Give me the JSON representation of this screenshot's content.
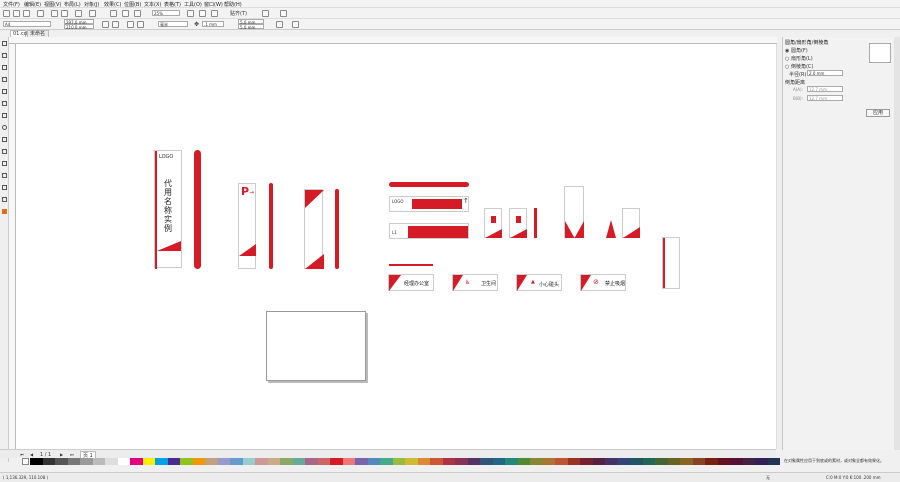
{
  "menu": [
    "文件(F)",
    "编辑(E)",
    "视图(V)",
    "布局(L)",
    "对象(J)",
    "效果(C)",
    "位图(B)",
    "文本(X)",
    "表格(T)",
    "工具(O)",
    "窗口(W)",
    "帮助(H)"
  ],
  "toolbar": {
    "zoom_value": "25%",
    "snap_label": "贴齐(T)",
    "page_size": "A4",
    "width_value": "297.0 mm",
    "height_value": "210.0 mm",
    "units_value": "毫米",
    "nudge_value": ".1 mm",
    "dup_x": "5.0 mm",
    "dup_y": "5.0 mm"
  },
  "doc_tabs": [
    "01.cdr",
    "未命名 -1"
  ],
  "panel": {
    "title": "圆角/扇形角/倒棱角",
    "options": [
      "圆角(F)",
      "扇形角(L)",
      "倒棱角(C)"
    ],
    "radius_label": "半径(R):",
    "radius_value": "2.0 mm",
    "distance_label": "倒角距离",
    "d1_label": "A(A):",
    "d1_value": "12.7 mm",
    "d2_label": "B(B):",
    "d2_value": "12.7 mm",
    "apply_label": "应用"
  },
  "signs": {
    "logo": "LOGO",
    "vertical_title": "代用名称实例",
    "parking": "P",
    "office": "经理办公室",
    "restroom": "卫生间",
    "caution": "小心碰头",
    "no_smoking": "禁止吸烟",
    "floor": "L1"
  },
  "page_nav": {
    "page_indicator": "1 / 1",
    "page_tab": "页 1"
  },
  "status": {
    "coords": "( 1,136.329, 110.108 )",
    "hint": "在对象属性应用于到底或的素材，或对象全都有效果化。",
    "color_info": "C:0 M:0 Y:0 K:100  .200 mm",
    "fill_label": "无"
  },
  "palette_colors": [
    "#000000",
    "#333333",
    "#555555",
    "#777777",
    "#999999",
    "#bbbbbb",
    "#dddddd",
    "#ffffff",
    "#e3007f",
    "#ffee00",
    "#00a0e9",
    "#4a2c8f",
    "#8fc31f",
    "#f39800",
    "#c0a080",
    "#9999cc",
    "#6699cc",
    "#99cccc",
    "#cc9999",
    "#ccaa88",
    "#88aa66",
    "#66aa99",
    "#aa6688",
    "#cc6666",
    "#d51b25",
    "#ee7777",
    "#7766aa",
    "#5588bb",
    "#44aa88",
    "#99bb44",
    "#ccbb33",
    "#dd8833",
    "#cc5533",
    "#aa3344",
    "#883355",
    "#553366",
    "#335577",
    "#226688",
    "#228877",
    "#558833",
    "#888833",
    "#aa7733",
    "#bb5533",
    "#993322",
    "#772233",
    "#552244",
    "#443366",
    "#334477",
    "#225566",
    "#226655",
    "#446633",
    "#666622",
    "#886622",
    "#884422",
    "#772211",
    "#661122",
    "#551133",
    "#442244",
    "#332255",
    "#223355"
  ]
}
